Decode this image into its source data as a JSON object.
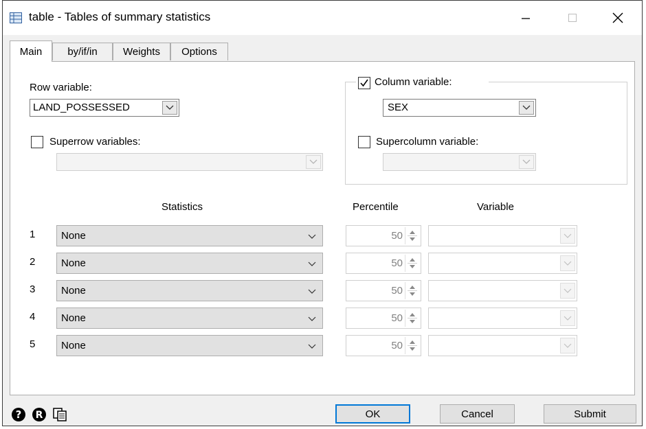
{
  "window": {
    "title": "table - Tables of summary statistics",
    "app_icon": "table-dialog-icon",
    "controls": [
      "minimize-icon",
      "maximize-icon",
      "close-icon"
    ]
  },
  "tabs": [
    {
      "label": "Main",
      "active": true
    },
    {
      "label": "by/if/in",
      "active": false
    },
    {
      "label": "Weights",
      "active": false
    },
    {
      "label": "Options",
      "active": false
    }
  ],
  "main": {
    "row_variable": {
      "label": "Row variable:",
      "value": "LAND_POSSESSED"
    },
    "superrow": {
      "label": "Superrow variables:",
      "checked": false,
      "value": ""
    },
    "column_variable": {
      "label": "Column variable:",
      "checked": true,
      "value": "SEX"
    },
    "supercolumn": {
      "label": "Supercolumn variable:",
      "checked": false,
      "value": ""
    },
    "headers": {
      "statistics": "Statistics",
      "percentile": "Percentile",
      "variable": "Variable"
    },
    "rows": [
      {
        "num": "1",
        "statistic": "None",
        "percentile": "50",
        "variable": ""
      },
      {
        "num": "2",
        "statistic": "None",
        "percentile": "50",
        "variable": ""
      },
      {
        "num": "3",
        "statistic": "None",
        "percentile": "50",
        "variable": ""
      },
      {
        "num": "4",
        "statistic": "None",
        "percentile": "50",
        "variable": ""
      },
      {
        "num": "5",
        "statistic": "None",
        "percentile": "50",
        "variable": ""
      }
    ]
  },
  "footer": {
    "icons": [
      "help-icon",
      "reset-icon",
      "copy-command-icon"
    ],
    "ok": "OK",
    "cancel": "Cancel",
    "submit": "Submit"
  },
  "colors": {
    "accent": "#0078d7",
    "dialog_bg": "#f0f0f0",
    "panel_bg": "#ffffff"
  }
}
